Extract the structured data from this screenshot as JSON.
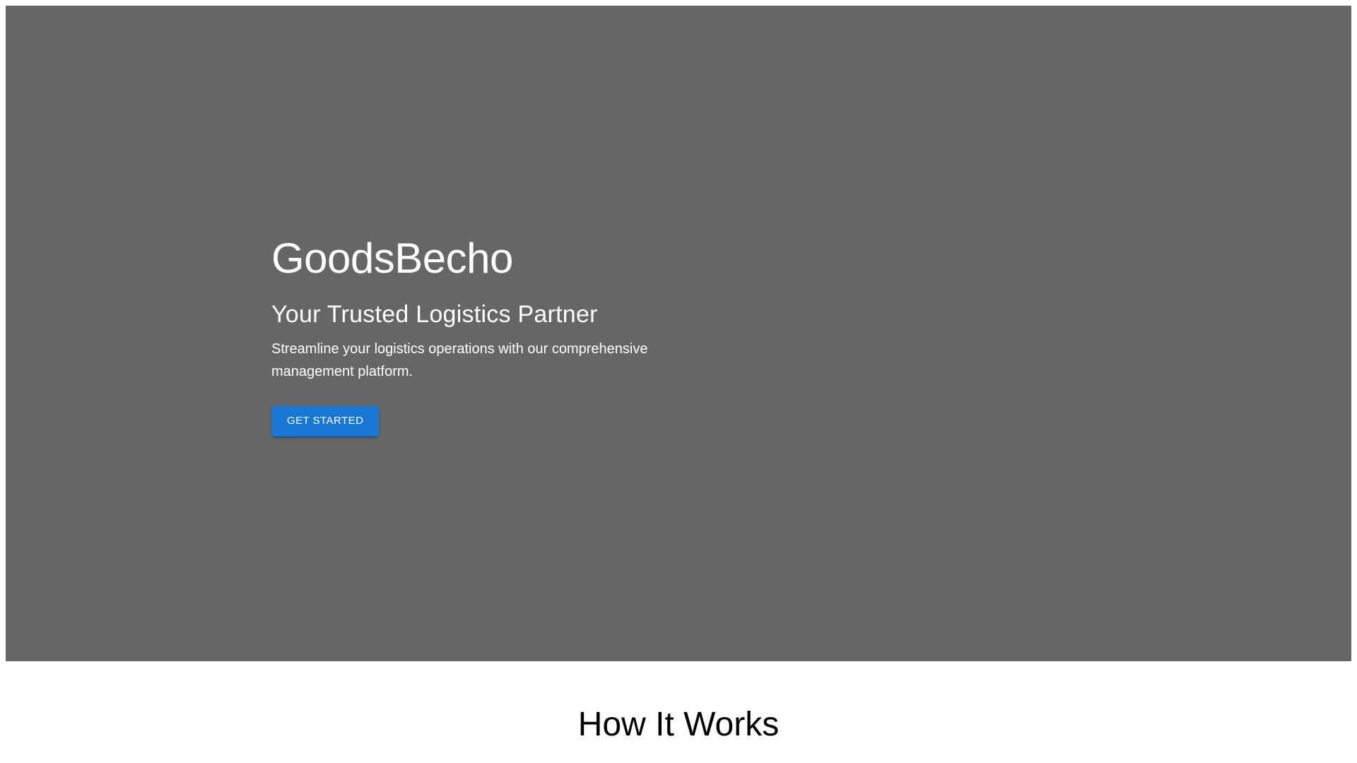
{
  "hero": {
    "title": "GoodsBecho",
    "subtitle": "Your Trusted Logistics Partner",
    "description": "Streamline your logistics operations with our comprehensive management platform.",
    "cta_label": "GET STARTED",
    "background_color": "#666666",
    "cta_color": "#1976d2"
  },
  "how_it_works": {
    "title": "How It Works"
  }
}
